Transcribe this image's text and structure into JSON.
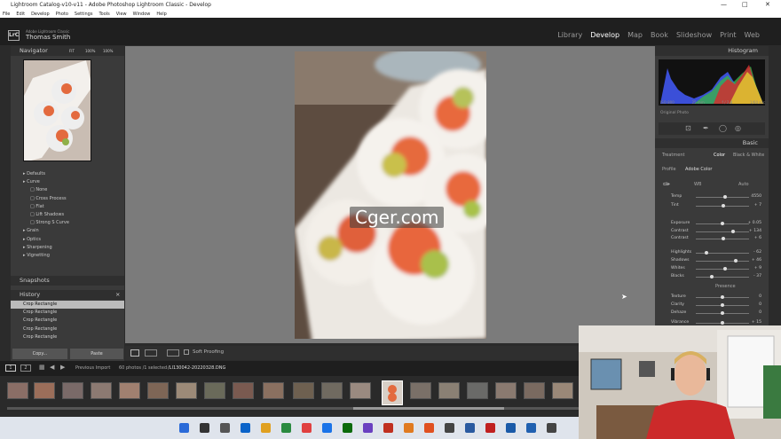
{
  "window": {
    "title": "Lightroom Catalog-v10-v11 - Adobe Photoshop Lightroom Classic - Develop"
  },
  "menu": [
    "File",
    "Edit",
    "Develop",
    "Photo",
    "Settings",
    "Tools",
    "View",
    "Window",
    "Help"
  ],
  "identity": {
    "app": "Adobe Lightroom Classic",
    "user": "Thomas Smith",
    "badge": "LrC"
  },
  "modules": [
    {
      "label": "Library",
      "active": false
    },
    {
      "label": "Develop",
      "active": true
    },
    {
      "label": "Map",
      "active": false
    },
    {
      "label": "Book",
      "active": false
    },
    {
      "label": "Slideshow",
      "active": false
    },
    {
      "label": "Print",
      "active": false
    },
    {
      "label": "Web",
      "active": false
    }
  ],
  "navigator": {
    "title": "Navigator",
    "zoom": [
      "FIT",
      "100%",
      "100%"
    ]
  },
  "presets": {
    "items": [
      "Defaults",
      "Curve",
      "None",
      "Cross Process",
      "Flat",
      "Lift Shadows",
      "Strong S Curve",
      "Grain",
      "Optics",
      "Sharpening",
      "Vignetting"
    ]
  },
  "snapshots": {
    "title": "Snapshots"
  },
  "history": {
    "title": "History",
    "items": [
      "Crop Rectangle",
      "Crop Rectangle",
      "Crop Rectangle",
      "Crop Rectangle",
      "Crop Rectangle"
    ]
  },
  "buttons": {
    "copy": "Copy...",
    "paste": "Paste"
  },
  "toolbar": {
    "soft_proofing": "Soft Proofing"
  },
  "histogram": {
    "title": "Histogram",
    "iso": "ISO 800",
    "lens": "25 mm",
    "aperture": "f / 2.8",
    "shutter": "1/60 sec",
    "original": "Original Photo"
  },
  "basic": {
    "title": "Basic",
    "treatment": "Treatment",
    "color": "Color",
    "bw": "Black & White",
    "profile_label": "Profile",
    "profile": "Adobe Color",
    "wb": "WB",
    "auto": "Auto"
  },
  "sliders": [
    {
      "label": "Temp",
      "value": "4550",
      "pos": 0.55
    },
    {
      "label": "Tint",
      "value": "+ 7",
      "pos": 0.52
    },
    {
      "label": "Exposure",
      "value": "+ 0.05",
      "pos": 0.5
    },
    {
      "label": "Contrast",
      "value": "+ 134",
      "pos": 0.7
    },
    {
      "label": "Contrast",
      "value": "+ 6",
      "pos": 0.52
    },
    {
      "label": "Highlights",
      "value": "- 62",
      "pos": 0.2
    },
    {
      "label": "Shadows",
      "value": "+ 46",
      "pos": 0.75
    },
    {
      "label": "Whites",
      "value": "+ 9",
      "pos": 0.55
    },
    {
      "label": "Blacks",
      "value": "- 37",
      "pos": 0.3
    }
  ],
  "presence": {
    "title": "Presence",
    "items": [
      {
        "label": "Texture",
        "value": "0"
      },
      {
        "label": "Clarity",
        "value": "0"
      },
      {
        "label": "Dehaze",
        "value": "0"
      },
      {
        "label": "Vibrance",
        "value": "+ 15"
      }
    ]
  },
  "filmstrip": {
    "source": "Previous Import",
    "count": "60 photos /1 selected",
    "file": "/LI130042-20220328.DNG"
  },
  "watermark": "Cger.com",
  "colors": {
    "accent": "#ffffff",
    "panel": "#3a3a3a",
    "center": "#7b7b7b"
  }
}
